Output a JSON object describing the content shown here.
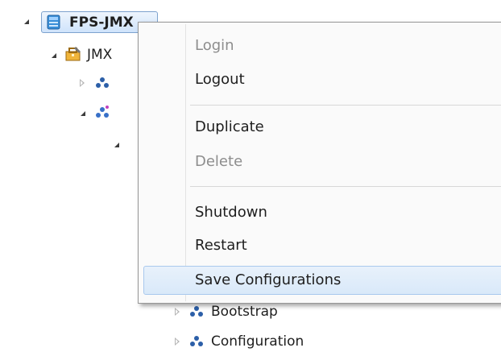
{
  "tree": {
    "root_label": "FPS-JMX",
    "child_label_fragment": "JMX",
    "bottom_items": [
      {
        "label": "Bootstrap"
      },
      {
        "label": "Configuration"
      }
    ]
  },
  "context_menu": {
    "items": [
      {
        "label": "Login",
        "enabled": false
      },
      {
        "label": "Logout",
        "enabled": true
      },
      {
        "label": "Duplicate",
        "enabled": true
      },
      {
        "label": "Delete",
        "enabled": false
      },
      {
        "label": "Shutdown",
        "enabled": true
      },
      {
        "label": "Restart",
        "enabled": true
      },
      {
        "label": "Save Configurations",
        "enabled": true,
        "highlighted": true
      }
    ]
  },
  "colors": {
    "selection_border": "#7da2ce",
    "menu_hover": "#d9e9f9",
    "disabled_text": "#8d8d8d",
    "server_icon": "#3a8fd8",
    "bundle_icon": "#2c5fa8"
  }
}
